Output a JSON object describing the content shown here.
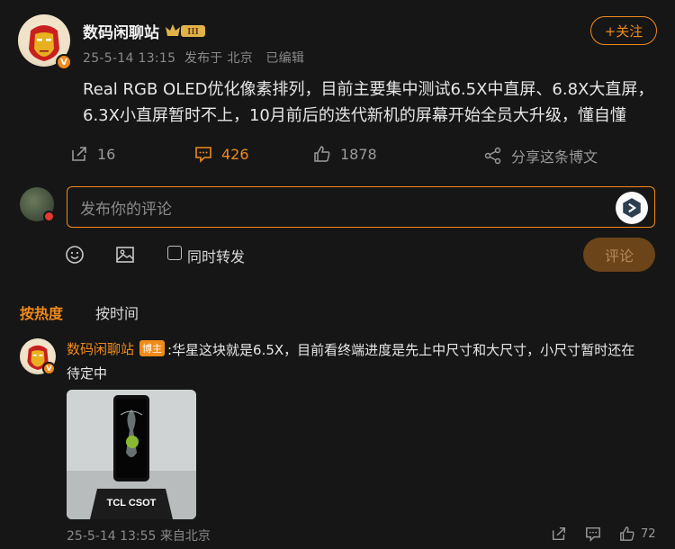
{
  "post": {
    "author": "数码闲聊站",
    "level_badge": "III",
    "meta": "25-5-14 13:15  发布于 北京   已编辑",
    "follow_label": "+关注",
    "text": "Real RGB OLED优化像素排列，目前主要集中测试6.5X中直屏、6.8X大直屏，6.3X小直屏暂时不上，10月前后的迭代新机的屏幕开始全员大升级，懂自懂",
    "avatar_badge": "V",
    "actions": {
      "repost_count": "16",
      "comment_count": "426",
      "like_count": "1878",
      "share_label": "分享这条博文"
    }
  },
  "composer": {
    "placeholder": "发布你的评论",
    "repost_option": "同时转发",
    "submit_label": "评论"
  },
  "sort_tabs": {
    "hot": "按热度",
    "time": "按时间"
  },
  "comment": {
    "author": "数码闲聊站",
    "role_badge": "博主",
    "text_line1": ":华星这块就是6.5X，目前看终端进度是先上中尺寸和大尺寸，小尺寸暂时还在",
    "text_line2": "待定中",
    "image_caption": "TCL CSOT",
    "meta": "25-5-14 13:55 来自北京",
    "like_count": "72",
    "avatar_badge": "V"
  },
  "colors": {
    "accent": "#f08a1a",
    "background": "#161616",
    "muted": "#8a8a8a"
  }
}
